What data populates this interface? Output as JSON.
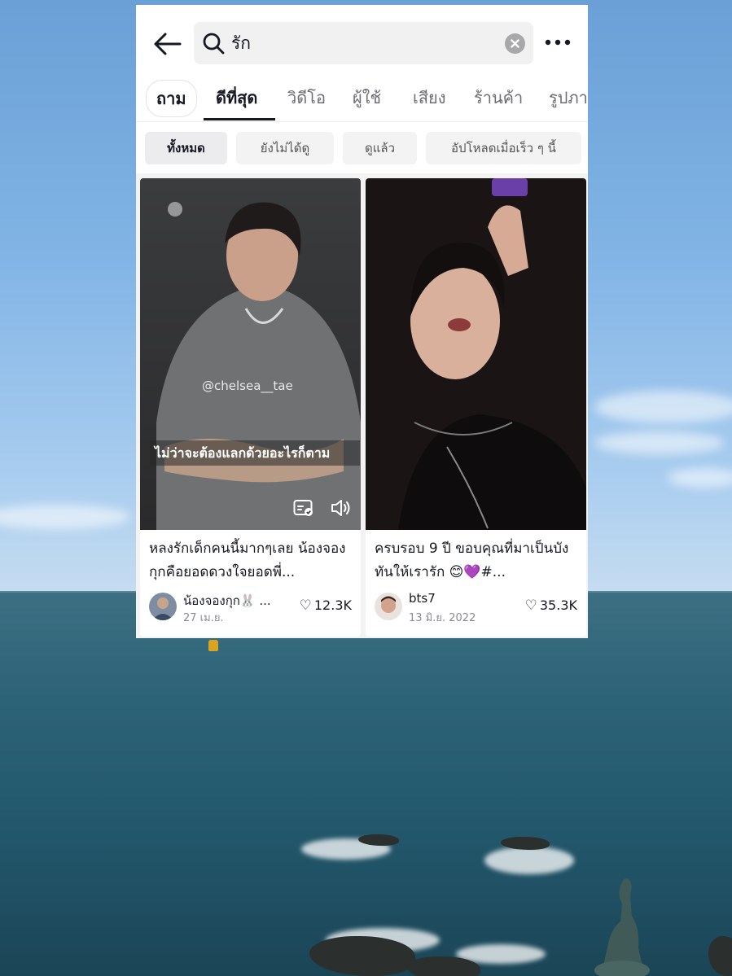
{
  "search": {
    "query": "รัก",
    "more_label": "•••"
  },
  "tabs": [
    {
      "label": "ถาม"
    },
    {
      "label": "ดีที่สุด",
      "active": true
    },
    {
      "label": "วิดีโอ"
    },
    {
      "label": "ผู้ใช้"
    },
    {
      "label": "เสียง"
    },
    {
      "label": "ร้านค้า"
    },
    {
      "label": "รูปภา"
    }
  ],
  "filters": [
    {
      "label": "ทั้งหมด",
      "active": true
    },
    {
      "label": "ยังไม่ได้ดู"
    },
    {
      "label": "ดูแล้ว"
    },
    {
      "label": "อัปโหลดเมื่อเร็ว ๆ นี้"
    }
  ],
  "results": [
    {
      "watermark": "@chelsea__tae",
      "overlay_caption": "ไม่ว่าจะต้องแลกด้วยอะไรก็ตาม",
      "caption": "หลงรักเด็กคนนี้มากๆเลย น้องจองกุกคือยอดดวงใจยอดพี่...",
      "author": "น้องจองกุก🐰 ...",
      "date": "27 เม.ย.",
      "likes": "12.3K"
    },
    {
      "caption": "ครบรอบ 9 ปี ขอบคุณที่มาเป็นบังทันให้เรารัก 😊💜#...",
      "author": "bts7",
      "date": "13 มิ.ย. 2022",
      "likes": "35.3K"
    }
  ],
  "colors": {
    "text_primary": "#161823",
    "text_secondary": "#6b6c74",
    "chip_bg": "#f3f3f4"
  },
  "icons": {
    "back": "arrow-left-icon",
    "search": "search-icon",
    "clear": "clear-icon",
    "more": "more-icon",
    "heart": "heart-icon",
    "captions": "captions-icon",
    "volume": "volume-icon"
  }
}
